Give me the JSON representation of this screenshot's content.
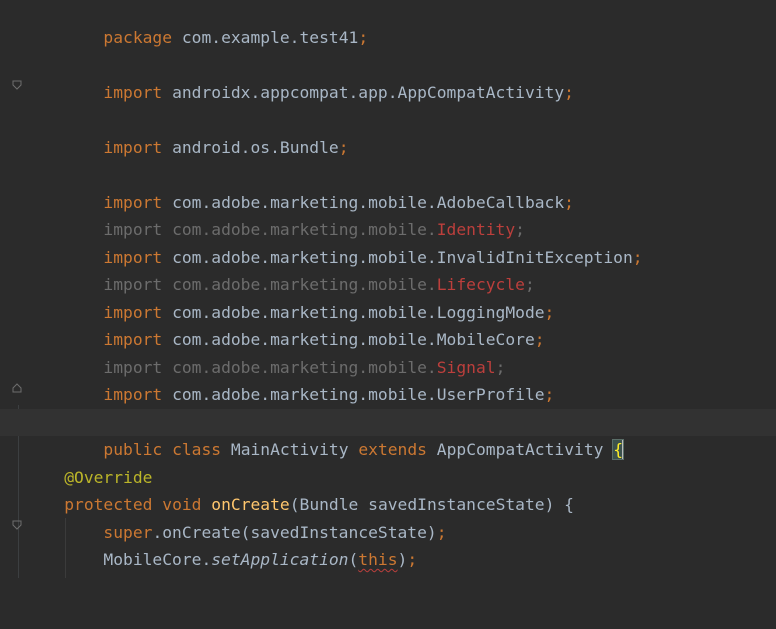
{
  "editor": {
    "lines": [
      {
        "id": "package",
        "kw": "package",
        "name": "com.example.test41",
        "semi": ";"
      },
      {
        "id": "import-appcompat",
        "kw": "import",
        "name": "androidx.appcompat.app.AppCompatActivity",
        "semi": ";"
      },
      {
        "id": "import-bundle",
        "kw": "import",
        "name": "android.os.Bundle",
        "semi": ";"
      },
      {
        "id": "import-adobecallback",
        "kw": "import",
        "name": "com.adobe.marketing.mobile.AdobeCallback",
        "semi": ";"
      },
      {
        "id": "import-identity",
        "kw": "import",
        "prefix": "com.adobe.marketing.mobile.",
        "cls": "Identity",
        "semi": ";"
      },
      {
        "id": "import-invalidinit",
        "kw": "import",
        "name": "com.adobe.marketing.mobile.InvalidInitException",
        "semi": ";"
      },
      {
        "id": "import-lifecycle",
        "kw": "import",
        "prefix": "com.adobe.marketing.mobile.",
        "cls": "Lifecycle",
        "semi": ";"
      },
      {
        "id": "import-loggingmode",
        "kw": "import",
        "name": "com.adobe.marketing.mobile.LoggingMode",
        "semi": ";"
      },
      {
        "id": "import-mobilecore",
        "kw": "import",
        "name": "com.adobe.marketing.mobile.MobileCore",
        "semi": ";"
      },
      {
        "id": "import-signal",
        "kw": "import",
        "prefix": "com.adobe.marketing.mobile.",
        "cls": "Signal",
        "semi": ";"
      },
      {
        "id": "import-userprofile",
        "kw": "import",
        "name": "com.adobe.marketing.mobile.UserProfile",
        "semi": ";"
      }
    ],
    "class_decl": {
      "kw_public": "public",
      "kw_class": "class",
      "name": "MainActivity",
      "kw_extends": "extends",
      "parent": "AppCompatActivity",
      "brace": "{"
    },
    "override": "@Override",
    "method_decl": {
      "kw_protected": "protected",
      "kw_void": "void",
      "name": "onCreate",
      "params": "(Bundle savedInstanceState) {"
    },
    "super_call": {
      "kw_super": "super",
      "rest": ".onCreate(savedInstanceState)",
      "semi": ";"
    },
    "set_app": {
      "obj": "MobileCore.",
      "method": "setApplication",
      "open": "(",
      "arg": "this",
      "close": ")",
      "semi": ";"
    },
    "colors": {
      "background": "#2b2b2b",
      "keyword": "#cc7832",
      "text": "#a9b7c6",
      "unused": "#6c6c6c",
      "error": "#bc3f3c",
      "annotation": "#bbb529",
      "method": "#ffc66d"
    },
    "icons": {
      "fold": "fold-marker-icon"
    }
  }
}
